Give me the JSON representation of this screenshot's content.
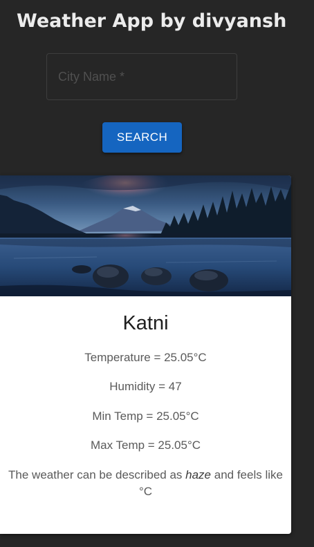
{
  "app": {
    "title": "Weather App by divyansh"
  },
  "search": {
    "placeholder": "City Name *",
    "value": "",
    "button_label": "SEARCH"
  },
  "weather": {
    "city": "Katni",
    "temperature": "Temperature = 25.05°C",
    "humidity": "Humidity = 47",
    "min_temp": "Min Temp = 25.05°C",
    "max_temp": "Max Temp = 25.05°C",
    "description_prefix": "The weather can be described as ",
    "condition": "haze",
    "description_suffix": " and feels like °C"
  },
  "colors": {
    "page_background": "#262626",
    "title_text": "#ececec",
    "button_primary": "#1565c0",
    "card_background": "#ffffff"
  }
}
